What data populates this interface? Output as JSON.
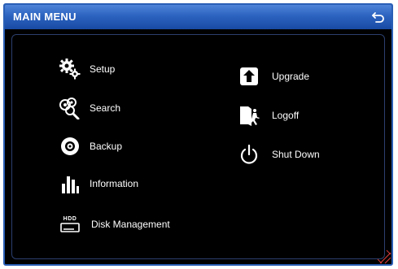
{
  "window": {
    "title": "MAIN MENU"
  },
  "menu": {
    "left": [
      {
        "label": "Setup",
        "icon": "gears-icon"
      },
      {
        "label": "Search",
        "icon": "search-icon"
      },
      {
        "label": "Backup",
        "icon": "disc-icon"
      },
      {
        "label": "Information",
        "icon": "bar-chart-icon"
      },
      {
        "label": "Disk Management",
        "icon": "hdd-icon"
      }
    ],
    "right": [
      {
        "label": "Upgrade",
        "icon": "upload-icon"
      },
      {
        "label": "Logoff",
        "icon": "exit-door-icon"
      },
      {
        "label": "Shut Down",
        "icon": "power-icon"
      }
    ],
    "hdd_badge": "HDD"
  },
  "colors": {
    "titlebar": "#2c63c0",
    "border": "#2a5fb6",
    "background": "#000000",
    "text": "#ffffff"
  }
}
